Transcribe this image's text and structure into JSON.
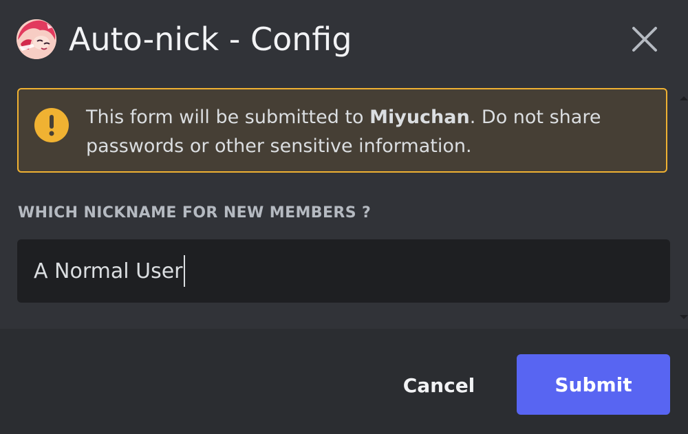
{
  "modal": {
    "title": "Auto-nick - Config",
    "avatar_icon": "anime-avatar-icon",
    "close_icon": "close-icon"
  },
  "notice": {
    "icon": "warning-icon",
    "text_before": "This form will be submitted to ",
    "bot_name": "Miyuchan",
    "text_after": ". Do not share passwords or other sensitive information.",
    "border_color": "#f0b232",
    "background_color": "#463f35"
  },
  "field": {
    "label": "WHICH NICKNAME FOR NEW MEMBERS ?",
    "value": "A Normal User"
  },
  "footer": {
    "cancel_label": "Cancel",
    "submit_label": "Submit",
    "submit_color": "#5865f2"
  },
  "theme": {
    "background": "#313338",
    "footer_background": "#2b2d31",
    "input_background": "#1e1f22"
  }
}
